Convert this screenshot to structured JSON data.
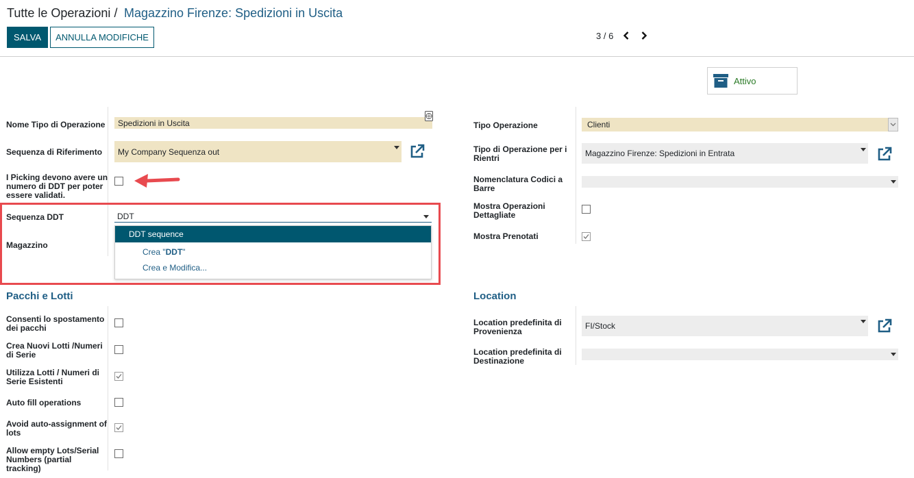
{
  "breadcrumb": {
    "root": "Tutte le Operazioni",
    "separator": "/",
    "current": "Magazzino Firenze: Spedizioni in Uscita"
  },
  "buttons": {
    "save": "SALVA",
    "discard": "ANNULLA MODIFICHE"
  },
  "pager": {
    "value": "3 / 6"
  },
  "button_box": {
    "active_label": "Attivo"
  },
  "left_fields": {
    "name_label": "Nome Tipo di Operazione",
    "name_value": "Spedizioni in Uscita",
    "sequence_label": "Sequenza di Riferimento",
    "sequence_value": "My Company Sequenza out",
    "picking_label": "I Picking devono avere un numero di DDT per poter essere validati.",
    "ddt_seq_label": "Sequenza DDT",
    "ddt_seq_value": "DDT",
    "warehouse_label": "Magazzino"
  },
  "dropdown": {
    "active_item": "DDT sequence",
    "create_prefix": "Crea \"",
    "create_term": "DDT",
    "create_suffix": "\"",
    "create_edit": "Crea e Modifica..."
  },
  "right_fields": {
    "op_type_label": "Tipo Operazione",
    "op_type_value": "Clienti",
    "return_type_label": "Tipo di Operazione per i Rientri",
    "return_type_value": "Magazzino Firenze: Spedizioni in Entrata",
    "barcode_label": "Nomenclatura Codici a Barre",
    "detailed_label": "Mostra Operazioni Dettagliate",
    "reserved_label": "Mostra Prenotati"
  },
  "lots_section": {
    "title": "Pacchi e Lotti",
    "items": [
      {
        "label": "Consenti lo spostamento dei pacchi",
        "checked": false
      },
      {
        "label": "Crea Nuovi Lotti /Numeri di Serie",
        "checked": false
      },
      {
        "label": "Utilizza Lotti / Numeri di Serie Esistenti",
        "checked": true
      },
      {
        "label": "Auto fill operations",
        "checked": false
      },
      {
        "label": "Avoid auto-assignment of lots",
        "checked": true
      },
      {
        "label": "Allow empty Lots/Serial Numbers (partial tracking)",
        "checked": false
      }
    ]
  },
  "location_section": {
    "title": "Location",
    "src_label": "Location predefinita di Provenienza",
    "src_value": "FI/Stock",
    "dest_label": "Location predefinita di Destinazione"
  },
  "colors": {
    "primary": "#00586f",
    "link": "#1f5e85",
    "required_bg": "#efe4c4",
    "highlight": "#e84a4f",
    "active_green": "#2a7a26"
  }
}
